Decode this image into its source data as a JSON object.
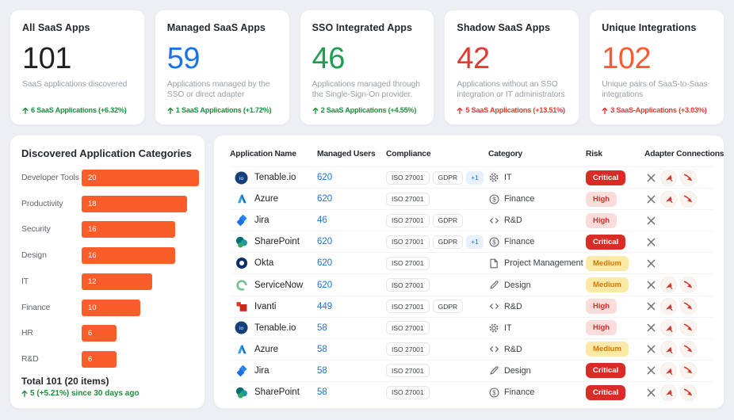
{
  "stats": [
    {
      "title": "All SaaS Apps",
      "value": "101",
      "value_color": "#202124",
      "desc": "SaaS applications discovered",
      "delta": "6 SaaS Applications (+6.32%)",
      "delta_color": "#1e8e3e"
    },
    {
      "title": "Managed SaaS Apps",
      "value": "59",
      "value_color": "#1a73e8",
      "desc": "Applications managed by the SSO or direct adapter",
      "delta": "1 SaaS Applications (+1.72%)",
      "delta_color": "#1e8e3e"
    },
    {
      "title": "SSO Integrated Apps",
      "value": "46",
      "value_color": "#1e9e50",
      "desc": "Applications managed through the Single-Sign-On provider.",
      "delta": "2 SaaS Applications (+4.55%)",
      "delta_color": "#1e8e3e"
    },
    {
      "title": "Shadow SaaS Apps",
      "value": "42",
      "value_color": "#e03a31",
      "desc": "Applications without an SSO integration or IT administrators",
      "delta": "5 SaaS Applications (+13.51%)",
      "delta_color": "#e03a31"
    },
    {
      "title": "Unique Integrations",
      "value": "102",
      "value_color": "#fa5b30",
      "desc": "Unique pairs of SaaS-to-Saas integrations",
      "delta": "3 SaaS-Applications (+3.03%)",
      "delta_color": "#e03a31"
    }
  ],
  "chart_data": {
    "type": "bar",
    "title": "Discovered Application Categories",
    "categories": [
      "Developer Tools",
      "Productivity",
      "Security",
      "Design",
      "IT",
      "Finance",
      "HR",
      "R&D"
    ],
    "values": [
      20,
      18,
      16,
      16,
      12,
      10,
      6,
      6
    ],
    "bar_color": "#f95d2a",
    "xlim": [
      0,
      20
    ],
    "footer_total": "Total 101 (20 items)",
    "footer_delta": "5 (+5.21%) since 30 days ago"
  },
  "table": {
    "columns": [
      "Application Name",
      "Managed Users",
      "Compliance",
      "Category",
      "Risk",
      "Adapter Connections"
    ],
    "rows": [
      {
        "app": "Tenable.io",
        "icon": "tenable",
        "users": "620",
        "compliance": [
          "ISO 27001",
          "GDPR",
          "+1"
        ],
        "category": "IT",
        "category_icon": "gear",
        "risk": "Critical",
        "adapters": [
          "x",
          "tool",
          "comet"
        ]
      },
      {
        "app": "Azure",
        "icon": "azure",
        "users": "620",
        "compliance": [
          "ISO 27001"
        ],
        "category": "Finance",
        "category_icon": "dollar",
        "risk": "High",
        "adapters": [
          "x",
          "tool",
          "comet"
        ]
      },
      {
        "app": "Jira",
        "icon": "jira",
        "users": "46",
        "compliance": [
          "ISO 27001",
          "GDPR"
        ],
        "category": "R&D",
        "category_icon": "code",
        "risk": "High",
        "adapters": [
          "x"
        ]
      },
      {
        "app": "SharePoint",
        "icon": "sharepoint",
        "users": "620",
        "compliance": [
          "ISO 27001",
          "GDPR",
          "+1"
        ],
        "category": "Finance",
        "category_icon": "dollar",
        "risk": "Critical",
        "adapters": [
          "x"
        ]
      },
      {
        "app": "Okta",
        "icon": "okta",
        "users": "620",
        "compliance": [
          "ISO 27001"
        ],
        "category": "Project Management",
        "category_icon": "doc",
        "risk": "Medium",
        "adapters": [
          "x"
        ]
      },
      {
        "app": "ServiceNow",
        "icon": "servicenow",
        "users": "620",
        "compliance": [
          "ISO 27001"
        ],
        "category": "Design",
        "category_icon": "pen",
        "risk": "Medium",
        "adapters": [
          "x",
          "tool",
          "comet"
        ]
      },
      {
        "app": "Ivanti",
        "icon": "ivanti",
        "users": "449",
        "compliance": [
          "ISO 27001",
          "GDPR"
        ],
        "category": "R&D",
        "category_icon": "code",
        "risk": "High",
        "adapters": [
          "x",
          "tool",
          "comet"
        ]
      },
      {
        "app": "Tenable.io",
        "icon": "tenable",
        "users": "58",
        "compliance": [
          "ISO 27001"
        ],
        "category": "IT",
        "category_icon": "gear",
        "risk": "High",
        "adapters": [
          "x",
          "tool",
          "comet"
        ]
      },
      {
        "app": "Azure",
        "icon": "azure",
        "users": "58",
        "compliance": [
          "ISO 27001"
        ],
        "category": "R&D",
        "category_icon": "code",
        "risk": "Medium",
        "adapters": [
          "x",
          "tool",
          "comet"
        ]
      },
      {
        "app": "Jira",
        "icon": "jira",
        "users": "58",
        "compliance": [
          "ISO 27001"
        ],
        "category": "Design",
        "category_icon": "pen",
        "risk": "Critical",
        "adapters": [
          "x",
          "tool",
          "comet"
        ]
      },
      {
        "app": "SharePoint",
        "icon": "sharepoint",
        "users": "58",
        "compliance": [
          "ISO 27001"
        ],
        "category": "Finance",
        "category_icon": "dollar",
        "risk": "Critical",
        "adapters": [
          "x",
          "tool",
          "comet"
        ]
      }
    ]
  }
}
